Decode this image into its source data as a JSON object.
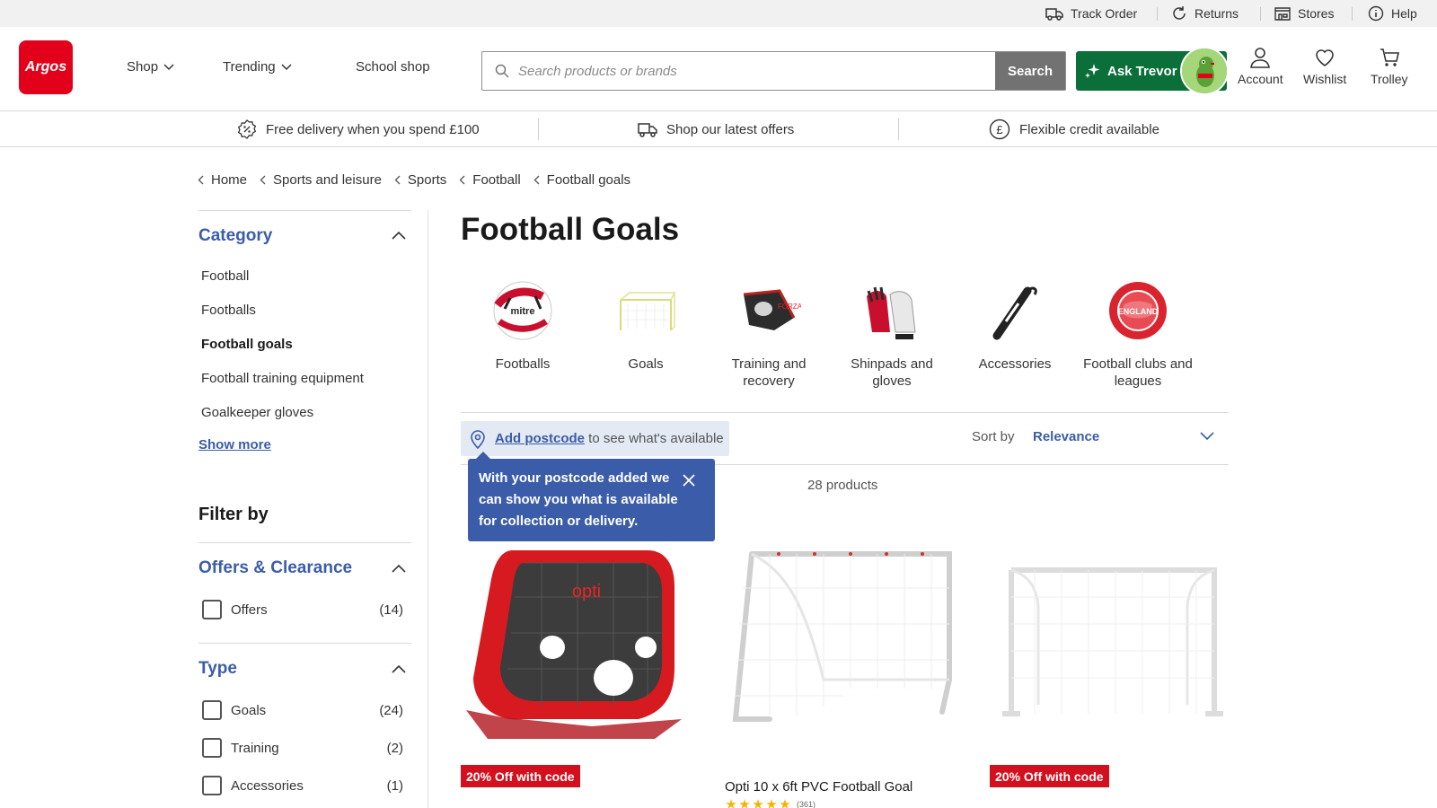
{
  "utility": {
    "track_order": "Track Order",
    "returns": "Returns",
    "stores": "Stores",
    "help": "Help"
  },
  "header": {
    "logo": "Argos",
    "nav": [
      "Shop",
      "Trending",
      "School shop"
    ],
    "search_placeholder": "Search products or brands",
    "search_button": "Search",
    "ask_trevor": "Ask Trevor",
    "account": "Account",
    "wishlist": "Wishlist",
    "trolley": "Trolley",
    "brand_color": "#e2001a",
    "trevor_color": "#0b6f39"
  },
  "usp": {
    "delivery": "Free delivery when you spend £100",
    "offers": "Shop our latest offers",
    "credit": "Flexible credit available"
  },
  "breadcrumb": [
    "Home",
    "Sports and leisure",
    "Sports",
    "Football",
    "Football goals"
  ],
  "sidebar": {
    "category_heading": "Category",
    "categories": [
      "Football",
      "Footballs",
      "Football goals",
      "Football training equipment",
      "Goalkeeper gloves"
    ],
    "active_category": "Football goals",
    "show_more": "Show more",
    "filter_by": "Filter by",
    "offers_heading": "Offers & Clearance",
    "offers": [
      {
        "label": "Offers",
        "count": "(14)"
      }
    ],
    "type_heading": "Type",
    "types": [
      {
        "label": "Goals",
        "count": "(24)"
      },
      {
        "label": "Training",
        "count": "(2)"
      },
      {
        "label": "Accessories",
        "count": "(1)"
      }
    ]
  },
  "main": {
    "title": "Football Goals",
    "category_tiles": [
      "Footballs",
      "Goals",
      "Training and recovery",
      "Shinpads and gloves",
      "Accessories",
      "Football clubs and leagues"
    ],
    "postcode_link": "Add postcode",
    "postcode_text": " to see what's available",
    "sort_label": "Sort by",
    "sort_value": "Relevance",
    "product_count": "28 products",
    "tooltip": "With your postcode added we can show you what is available for collection or delivery.",
    "products": [
      {
        "badge": "20% Off with code",
        "name": ""
      },
      {
        "badge": "",
        "name": "Opti 10 x 6ft PVC Football Goal",
        "rating_count": "(361)",
        "rating": 5
      },
      {
        "badge": "20% Off with code",
        "name": ""
      }
    ],
    "accent_color": "#3b5ca8",
    "badge_color": "#d3101e"
  }
}
